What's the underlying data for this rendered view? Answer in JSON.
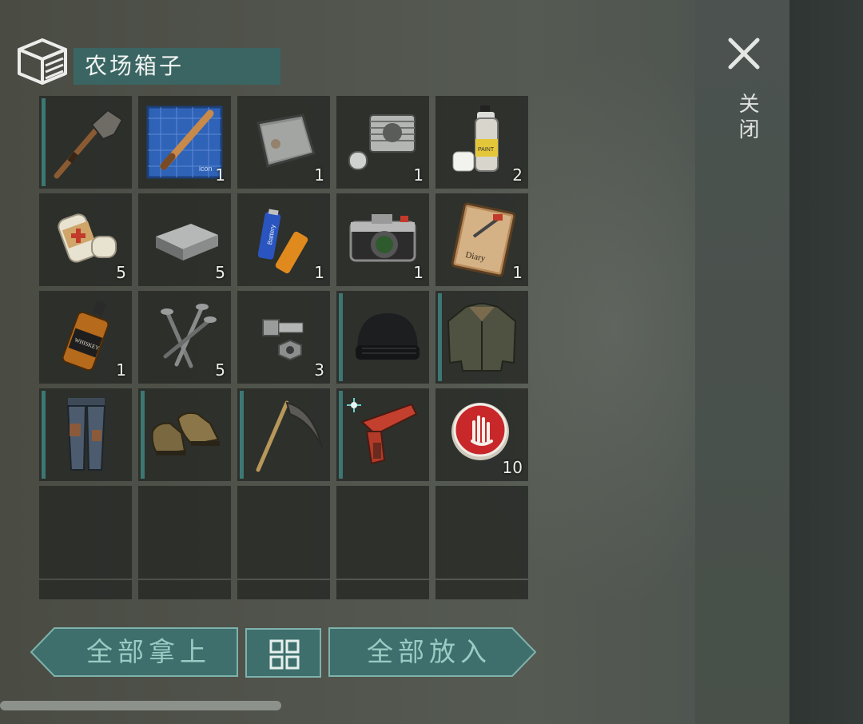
{
  "container": {
    "title": "农场箱子",
    "icon": "crate-icon"
  },
  "close": {
    "icon": "close-icon",
    "label": "关闭"
  },
  "inventory": {
    "slots": [
      {
        "item": "shovel",
        "count": "",
        "equip": true
      },
      {
        "item": "bat-blueprint",
        "count": "1",
        "equip": false
      },
      {
        "item": "metal-plate",
        "count": "1",
        "equip": false
      },
      {
        "item": "engine-cylinder",
        "count": "1",
        "equip": false
      },
      {
        "item": "spray-paint",
        "count": "2",
        "equip": false
      },
      {
        "item": "bandage",
        "count": "5",
        "equip": false
      },
      {
        "item": "iron-ingot",
        "count": "5",
        "equip": false
      },
      {
        "item": "batteries",
        "count": "1",
        "equip": false
      },
      {
        "item": "camera",
        "count": "1",
        "equip": false
      },
      {
        "item": "diary",
        "count": "1",
        "equip": false
      },
      {
        "item": "whiskey",
        "count": "1",
        "equip": false
      },
      {
        "item": "nails",
        "count": "5",
        "equip": false
      },
      {
        "item": "bolt-nut",
        "count": "3",
        "equip": false
      },
      {
        "item": "beanie",
        "count": "",
        "equip": true
      },
      {
        "item": "jacket",
        "count": "",
        "equip": true
      },
      {
        "item": "pants",
        "count": "",
        "equip": true
      },
      {
        "item": "boots",
        "count": "",
        "equip": true
      },
      {
        "item": "sickle",
        "count": "",
        "equip": true
      },
      {
        "item": "flare-gun",
        "count": "",
        "equip": true
      },
      {
        "item": "bottle-cap",
        "count": "10",
        "equip": false
      }
    ],
    "item_labels": {
      "blueprint_text": "icon",
      "battery_text": "Battery",
      "paint_text": "PAINT",
      "whiskey_text": "WHISKEY",
      "diary_text": "Diary"
    }
  },
  "actions": {
    "take_all": "全部拿上",
    "sort_icon": "sort-grid-icon",
    "put_all": "全部放入"
  },
  "colors": {
    "accent": "#3a6563",
    "button_text": "#99ccc4",
    "slot_bg": "#262824",
    "equip_marker": "#3c7773"
  }
}
